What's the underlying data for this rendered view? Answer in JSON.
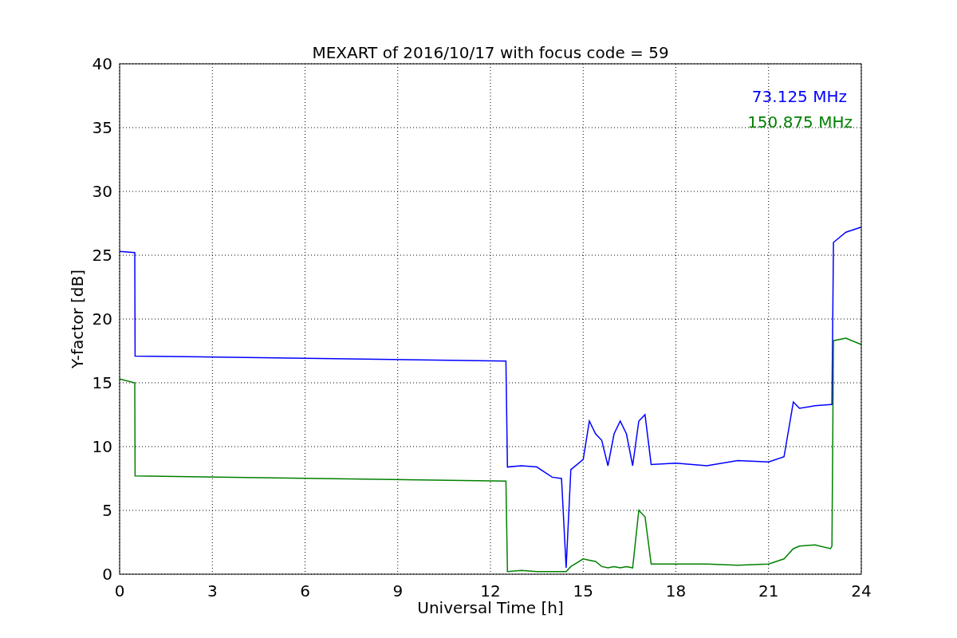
{
  "figure": {
    "chart_data": {
      "type": "line",
      "title": "MEXART of 2016/10/17 with focus code = 59",
      "xlabel": "Universal Time [h]",
      "ylabel": "Y-factor [dB]",
      "x": [
        0,
        0.49,
        0.5,
        12.5,
        12.55,
        13,
        13.5,
        14,
        14.3,
        14.45,
        14.6,
        15,
        15.2,
        15.4,
        15.6,
        15.8,
        16,
        16.2,
        16.4,
        16.6,
        16.8,
        17,
        17.2,
        18,
        19,
        20,
        21,
        21.5,
        21.8,
        22,
        22.5,
        23,
        23.05,
        23.1,
        23.5,
        24
      ],
      "series": [
        {
          "name": "73.125 MHz",
          "color": "#0000ff",
          "values": [
            25.3,
            25.2,
            17.1,
            16.7,
            8.4,
            8.5,
            8.4,
            7.6,
            7.5,
            0.5,
            8.2,
            9,
            12,
            11,
            10.5,
            8.5,
            11,
            12,
            11,
            8.5,
            12,
            12.5,
            8.6,
            8.7,
            8.5,
            8.9,
            8.8,
            9.2,
            13.5,
            13,
            13.2,
            13.3,
            13.3,
            26,
            26.8,
            27.2
          ]
        },
        {
          "name": "150.875 MHz",
          "color": "#008000",
          "values": [
            15.3,
            15,
            7.7,
            7.3,
            0.2,
            0.3,
            0.2,
            0.2,
            0.2,
            0.2,
            0.6,
            1.2,
            1.1,
            1.0,
            0.6,
            0.5,
            0.6,
            0.5,
            0.6,
            0.5,
            5,
            4.5,
            0.8,
            0.8,
            0.8,
            0.7,
            0.8,
            1.2,
            2,
            2.2,
            2.3,
            2,
            2.2,
            18.3,
            18.5,
            18
          ]
        }
      ],
      "xlim": [
        0,
        24
      ],
      "ylim": [
        0,
        40
      ],
      "xticks": [
        0,
        3,
        6,
        9,
        12,
        15,
        18,
        21,
        24
      ],
      "yticks": [
        0,
        5,
        10,
        15,
        20,
        25,
        30,
        35,
        40
      ],
      "grid": true
    }
  }
}
